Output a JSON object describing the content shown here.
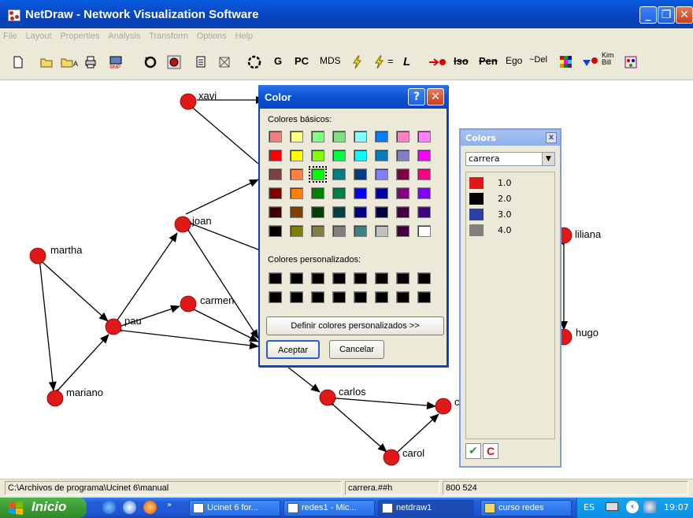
{
  "window": {
    "title": "NetDraw - Network Visualization Software"
  },
  "menu": [
    "File",
    "Layout",
    "Properties",
    "Analysis",
    "Transform",
    "Options",
    "Help"
  ],
  "toolbar": {
    "text_buttons": {
      "g": "G",
      "pc": "PC",
      "mds": "MDS",
      "lightning_eq": "=",
      "l": "L",
      "iso": "Iso",
      "pen": "Pen",
      "ego": "Ego",
      "del": "~Del",
      "kim": "Kim",
      "bill": "Bill"
    }
  },
  "network": {
    "node_color": "#e01818",
    "nodes": [
      {
        "id": "xavi",
        "label": "xavi"
      },
      {
        "id": "joan",
        "label": "joan"
      },
      {
        "id": "martha",
        "label": "martha"
      },
      {
        "id": "pau",
        "label": "pau"
      },
      {
        "id": "carmen",
        "label": "carmen"
      },
      {
        "id": "mariano",
        "label": "mariano"
      },
      {
        "id": "carlos",
        "label": "carlos"
      },
      {
        "id": "carol",
        "label": "carol"
      },
      {
        "id": "c_partial",
        "label": "c"
      },
      {
        "id": "liliana",
        "label": "liliana"
      },
      {
        "id": "hugo",
        "label": "hugo"
      }
    ]
  },
  "color_dialog": {
    "title": "Color",
    "help_button": "?",
    "close_button": "✕",
    "basic_colors_label": "Colores básicos:",
    "custom_colors_label": "Colores personalizados:",
    "define_custom_button": "Definir colores personalizados >>",
    "accept_button": "Aceptar",
    "cancel_button": "Cancelar",
    "basic_colors": [
      [
        "#f08080",
        "#ffff80",
        "#80ff80",
        "#80e080",
        "#80ffff",
        "#0080ff",
        "#ff80c0",
        "#ff80ff"
      ],
      [
        "#ff0000",
        "#ffff00",
        "#80ff00",
        "#00ff40",
        "#00ffff",
        "#0080c0",
        "#8080c0",
        "#ff00ff"
      ],
      [
        "#804040",
        "#ff8040",
        "#00ff00",
        "#008080",
        "#004080",
        "#8080ff",
        "#800040",
        "#ff0080"
      ],
      [
        "#800000",
        "#ff8000",
        "#008000",
        "#008040",
        "#0000ff",
        "#0000a0",
        "#800080",
        "#8000ff"
      ],
      [
        "#400000",
        "#804000",
        "#004000",
        "#004040",
        "#000080",
        "#000040",
        "#400040",
        "#400080"
      ],
      [
        "#000000",
        "#808000",
        "#808040",
        "#808080",
        "#408080",
        "#c0c0c0",
        "#400040",
        "#ffffff"
      ]
    ],
    "selected_color": "#00ff00",
    "custom_colors_count": 16
  },
  "colors_panel": {
    "title": "Colors",
    "close": "x",
    "attribute": "carrera",
    "entries": [
      {
        "color": "#e01818",
        "label": "1.0"
      },
      {
        "color": "#000000",
        "label": "2.0"
      },
      {
        "color": "#2a3fa8",
        "label": "3.0"
      },
      {
        "color": "#808080",
        "label": "4.0"
      }
    ],
    "ok_symbol": "✔",
    "c_label": "C"
  },
  "statusbar": {
    "path": "C:\\Archivos de programa\\Ucinet 6\\manual",
    "field2": "carrera.##h",
    "coords": "800 524"
  },
  "taskbar": {
    "start": "Inicio",
    "tasks": [
      {
        "label": "Ucinet 6 for...",
        "active": false
      },
      {
        "label": "redes1 - Mic...",
        "active": false
      },
      {
        "label": "netdraw1",
        "active": true
      },
      {
        "label": "curso redes",
        "active": false
      }
    ],
    "lang": "ES",
    "clock": "19:07"
  }
}
